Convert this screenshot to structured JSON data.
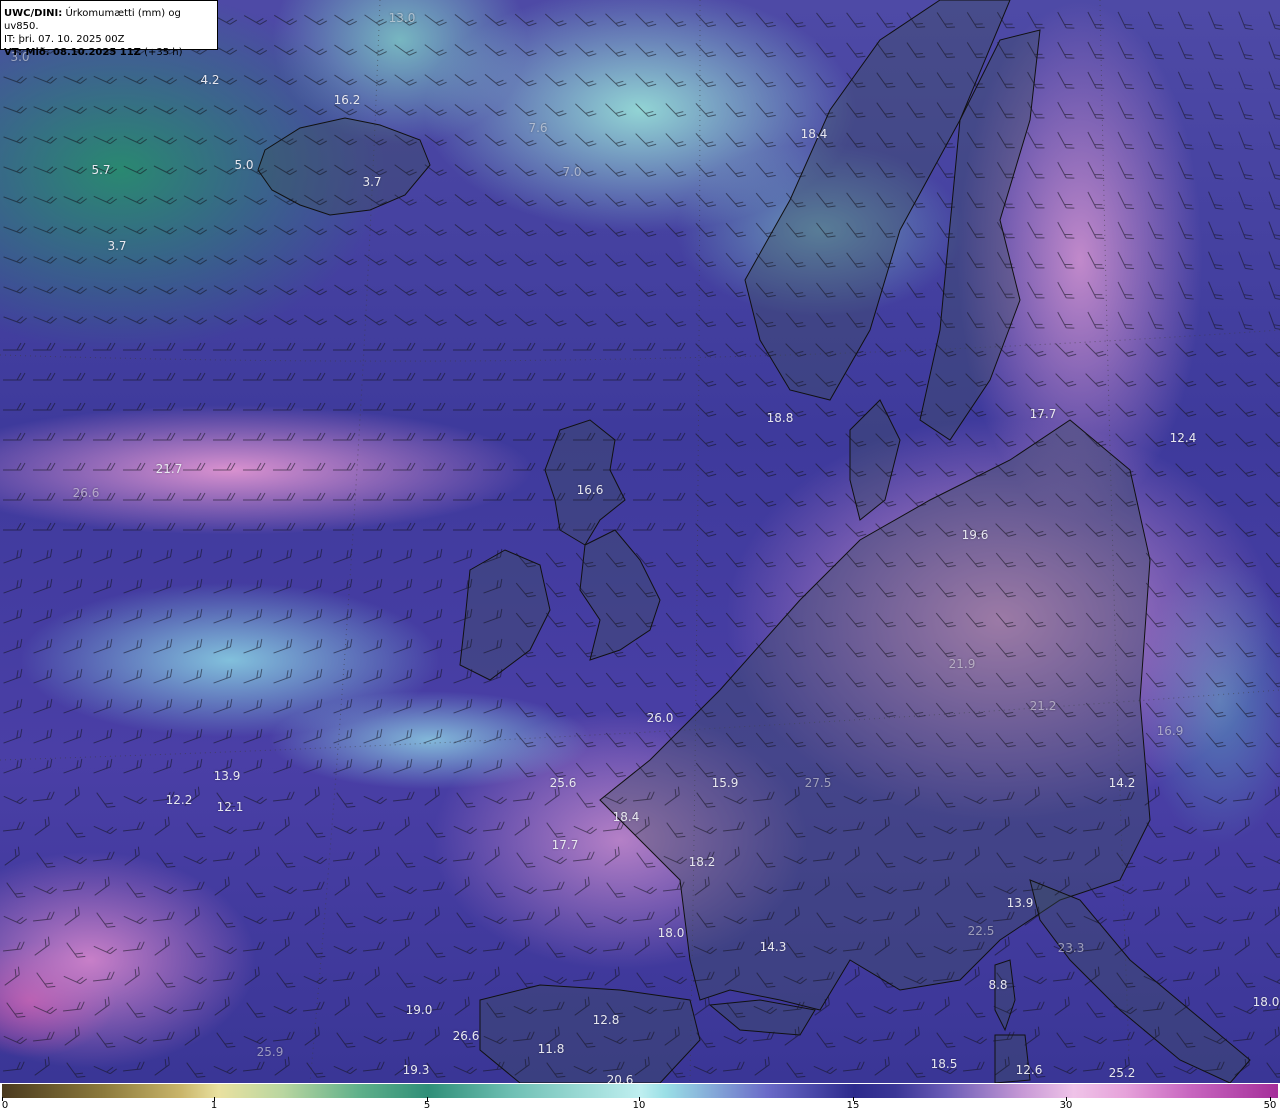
{
  "header": {
    "line1_bold": "UWC/DINI:",
    "line1_rest": " Úrkomumætti (mm) og uv850.",
    "line2": "IT: þri. 07. 10. 2025 00Z",
    "line3_bold": "VT: Mið. 08.10.2025 11Z",
    "line3_rest": " (+35 h)"
  },
  "colorbar": {
    "ticks": [
      "0",
      "1",
      "5",
      "10",
      "15",
      "30",
      "50"
    ],
    "tick_values": [
      0,
      1,
      5,
      10,
      15,
      30,
      50
    ],
    "colors": [
      "#4a3a1e",
      "#e9e1a0",
      "#2f8f78",
      "#bfeff0",
      "#2c2a8c",
      "#efc3e8",
      "#a52f9a"
    ]
  },
  "map_labels": [
    {
      "text": "13.0",
      "faint": true
    },
    {
      "text": "3.0",
      "faint": true
    },
    {
      "text": "4.2",
      "faint": false
    },
    {
      "text": "16.2",
      "faint": false
    },
    {
      "text": "5.7",
      "faint": false
    },
    {
      "text": "5.0",
      "faint": false
    },
    {
      "text": "3.7",
      "faint": false
    },
    {
      "text": "3.7",
      "faint": false
    },
    {
      "text": "7.6",
      "faint": true
    },
    {
      "text": "7.0",
      "faint": true
    },
    {
      "text": "18.4",
      "faint": false
    },
    {
      "text": "18.8",
      "faint": false
    },
    {
      "text": "17.7",
      "faint": false
    },
    {
      "text": "12.4",
      "faint": false
    },
    {
      "text": "21.7",
      "faint": false
    },
    {
      "text": "26.6",
      "faint": true
    },
    {
      "text": "16.6",
      "faint": false
    },
    {
      "text": "19.6",
      "faint": false
    },
    {
      "text": "26.0",
      "faint": false
    },
    {
      "text": "21.9",
      "faint": true
    },
    {
      "text": "21.2",
      "faint": true
    },
    {
      "text": "16.9",
      "faint": true
    },
    {
      "text": "13.9",
      "faint": false
    },
    {
      "text": "12.2",
      "faint": false
    },
    {
      "text": "12.1",
      "faint": false
    },
    {
      "text": "25.6",
      "faint": false
    },
    {
      "text": "15.9",
      "faint": false
    },
    {
      "text": "27.5",
      "faint": true
    },
    {
      "text": "14.2",
      "faint": false
    },
    {
      "text": "18.4",
      "faint": false
    },
    {
      "text": "17.7",
      "faint": false
    },
    {
      "text": "18.2",
      "faint": false
    },
    {
      "text": "18.0",
      "faint": false
    },
    {
      "text": "14.3",
      "faint": false
    },
    {
      "text": "13.9",
      "faint": false
    },
    {
      "text": "22.5",
      "faint": true
    },
    {
      "text": "23.3",
      "faint": true
    },
    {
      "text": "8.8",
      "faint": false
    },
    {
      "text": "19.0",
      "faint": false
    },
    {
      "text": "26.6",
      "faint": false
    },
    {
      "text": "12.8",
      "faint": false
    },
    {
      "text": "11.8",
      "faint": false
    },
    {
      "text": "19.3",
      "faint": false
    },
    {
      "text": "20.6",
      "faint": false
    },
    {
      "text": "18.5",
      "faint": false
    },
    {
      "text": "12.6",
      "faint": false
    },
    {
      "text": "25.2",
      "faint": false
    },
    {
      "text": "18.0",
      "faint": false
    },
    {
      "text": "25.9",
      "faint": true
    }
  ]
}
